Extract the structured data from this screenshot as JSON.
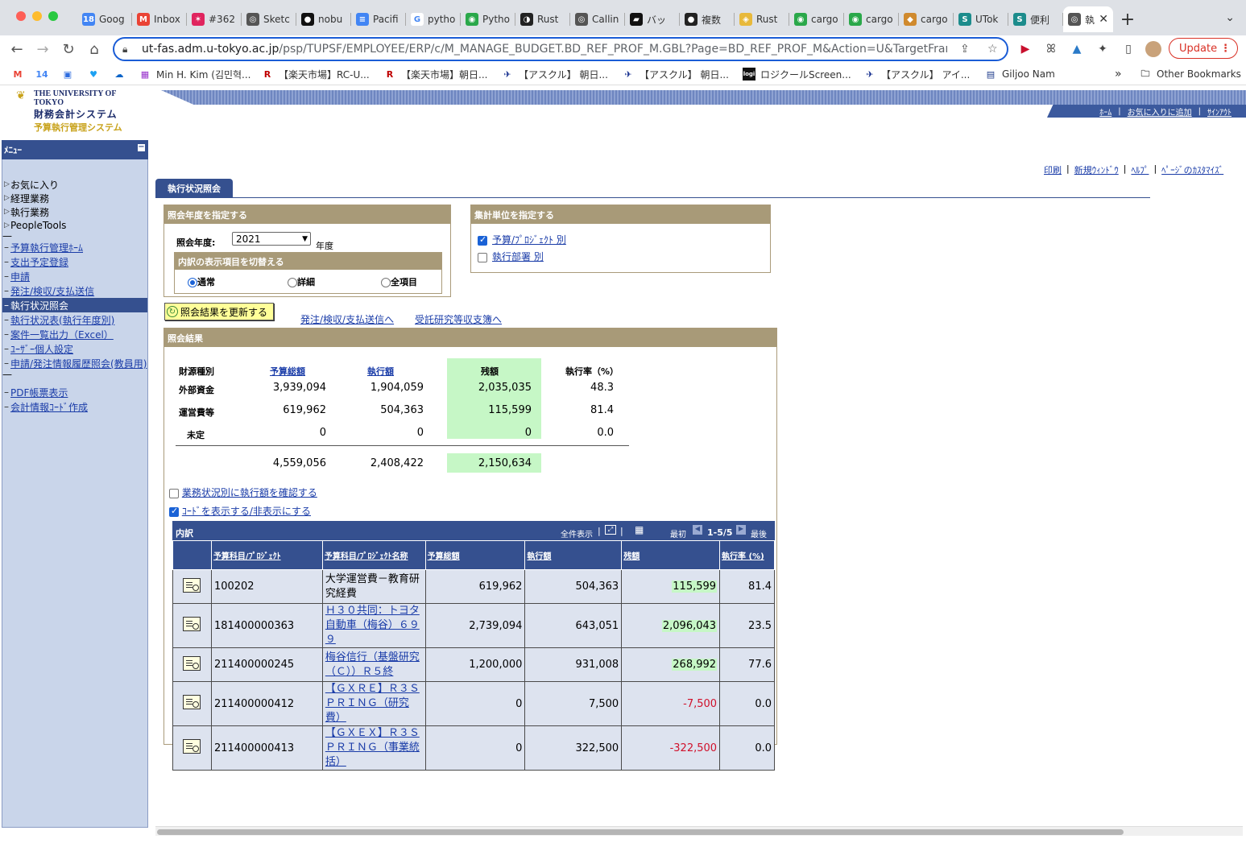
{
  "browser": {
    "tabs": [
      {
        "label": "Goog",
        "fav_color": "#4285f4",
        "fav": "18"
      },
      {
        "label": "Inbox",
        "fav_color": "#ea4335",
        "fav": "M"
      },
      {
        "label": "#362",
        "fav_color": "#e0245e",
        "fav": "✶"
      },
      {
        "label": "Sketc",
        "fav_color": "#555555",
        "fav": "◎"
      },
      {
        "label": "nobu",
        "fav_color": "#111111",
        "fav": "●"
      },
      {
        "label": "Pacifi",
        "fav_color": "#4285f4",
        "fav": "≡"
      },
      {
        "label": "pytho",
        "fav_color": "#ffffff",
        "fav": "G"
      },
      {
        "label": "Pytho",
        "fav_color": "#2aa84a",
        "fav": "◉"
      },
      {
        "label": "Rust",
        "fav_color": "#222222",
        "fav": "◑"
      },
      {
        "label": "Callin",
        "fav_color": "#555555",
        "fav": "◎"
      },
      {
        "label": "バッ",
        "fav_color": "#111111",
        "fav": "▰"
      },
      {
        "label": "複数",
        "fav_color": "#222222",
        "fav": "●"
      },
      {
        "label": "Rust",
        "fav_color": "#e8b93b",
        "fav": "◈"
      },
      {
        "label": "cargo",
        "fav_color": "#2aa84a",
        "fav": "◉"
      },
      {
        "label": "cargo",
        "fav_color": "#2aa84a",
        "fav": "◉"
      },
      {
        "label": "cargo",
        "fav_color": "#d08a2e",
        "fav": "◆"
      },
      {
        "label": "UTok",
        "fav_color": "#1c8c8c",
        "fav": "S"
      },
      {
        "label": "便利",
        "fav_color": "#1c8c8c",
        "fav": "S"
      }
    ],
    "active_tab": {
      "label": "執",
      "fav": "◎"
    },
    "new_tab_icon": "+",
    "url_host": "ut-fas.adm.u-tokyo.ac.jp",
    "url_path": "/psp/TUPSF/EMPLOYEE/ERP/c/M_MANAGE_BUDGET.BD_REF_PROF_M.GBL?Page=BD_REF_PROF_M&Action=U&TargetFram...",
    "update_label": "Update",
    "bookmarks": [
      {
        "label": "",
        "icon": "M",
        "color": "#ea4335"
      },
      {
        "label": "",
        "icon": "14",
        "color": "#4285f4"
      },
      {
        "label": "",
        "icon": "▣",
        "color": "#2d6cdf"
      },
      {
        "label": "",
        "icon": "♥",
        "color": "#1da1f2"
      },
      {
        "label": "",
        "icon": "☁",
        "color": "#0a64c8"
      },
      {
        "label": "Min H. Kim (김민혁...",
        "icon": "▦",
        "color": "#9933cc"
      },
      {
        "label": "【楽天市場】RC-U...",
        "icon": "R",
        "color": "#bf0000"
      },
      {
        "label": "【楽天市場】朝日...",
        "icon": "R",
        "color": "#bf0000"
      },
      {
        "label": "【アスクル】 朝日...",
        "icon": "✈",
        "color": "#102a8c"
      },
      {
        "label": "【アスクル】 朝日...",
        "icon": "✈",
        "color": "#102a8c"
      },
      {
        "label": "ロジクールScreen...",
        "icon": "logi",
        "color": "#111111"
      },
      {
        "label": "【アスクル】 アイ...",
        "icon": "✈",
        "color": "#102a8c"
      },
      {
        "label": "Giljoo Nam",
        "icon": "▤",
        "color": "#1d3a8a"
      }
    ],
    "bookmarks_more": "»",
    "other_bookmarks": "Other Bookmarks"
  },
  "header": {
    "logo_line1": "THE UNIVERSITY OF TOKYO",
    "logo_line2": "財務会計システム",
    "logo_line3": "予算執行管理システム",
    "nav": [
      "ﾎｰﾑ",
      "お気に入りに追加",
      "ｻｲﾝｱｳﾄ"
    ],
    "util_links": [
      "印刷",
      "新規ｳｨﾝﾄﾞｳ",
      "ﾍﾙﾌﾟ",
      "ﾍﾟｰｼﾞのｶｽﾀﾏｲｽﾞ"
    ]
  },
  "menu": {
    "title": "ﾒﾆｭｰ",
    "folders": [
      "お気に入り",
      "経理業務",
      "執行業務",
      "PeopleTools"
    ],
    "links_a": [
      "予算執行管理ﾎｰﾑ",
      "支出予定登録",
      "申請",
      "発注/検収/支払送信"
    ],
    "active": "執行状況照会",
    "links_b": [
      "執行状況表(執行年度別)",
      "案件一覧出力（Excel）",
      "ﾕｰｻﾞｰ個人設定",
      "申請/発注情報履歴照会(教員用)"
    ],
    "links_c": [
      "PDF帳票表示",
      "会計情報ｺｰﾄﾞ作成"
    ]
  },
  "page_tab": "執行状況照会",
  "year_box": {
    "title": "照会年度を指定する",
    "label": "照会年度:",
    "value": "2021",
    "suffix": "年度",
    "sub_title": "内訳の表示項目を切替える",
    "radios": [
      {
        "label": "通常",
        "checked": true
      },
      {
        "label": "詳細",
        "checked": false
      },
      {
        "label": "全項目",
        "checked": false
      }
    ]
  },
  "unit_box": {
    "title": "集計単位を指定する",
    "checks": [
      {
        "label": "予算/ﾌﾟﾛｼﾞｪｸﾄ 別",
        "checked": true
      },
      {
        "label": "執行部署 別",
        "checked": false
      }
    ]
  },
  "actions": {
    "refresh": "照会結果を更新する",
    "link1": "発注/検収/支払送信へ",
    "link2": "受託研究等収支簿へ"
  },
  "results": {
    "title": "照会結果",
    "headers": [
      "財源種別",
      "予算総額",
      "執行額",
      "残額",
      "執行率（%）"
    ],
    "rows": [
      [
        "外部資金",
        "3,939,094",
        "1,904,059",
        "2,035,035",
        "48.3"
      ],
      [
        "運営費等",
        "619,962",
        "504,363",
        "115,599",
        "81.4"
      ],
      [
        "未定",
        "0",
        "0",
        "0",
        "0.0"
      ]
    ],
    "totals": [
      "4,559,056",
      "2,408,422",
      "2,150,634"
    ],
    "check1": "業務状況別に執行額を確認する",
    "check2": "ｺｰﾄﾞを表示する/非表示にする",
    "check1_on": false,
    "check2_on": true
  },
  "detail": {
    "title": "内訳",
    "show_all": "全件表示",
    "first": "最初",
    "range": "1-5/5",
    "last": "最後",
    "headers": [
      "予算科目/ﾌﾟﾛｼﾞｪｸﾄ",
      "予算科目/ﾌﾟﾛｼﾞｪｸﾄ名称",
      "予算総額",
      "執行額",
      "残額",
      "執行率 (%)"
    ],
    "rows": [
      {
        "code": "100202",
        "name": "大学運営費－教育研究経費",
        "link": false,
        "budget": "619,962",
        "exec": "504,363",
        "rest": "115,599",
        "neg": false,
        "rate": "81.4"
      },
      {
        "code": "181400000363",
        "name": "Ｈ３０共同：トヨタ自動車（梅谷）６９９",
        "link": true,
        "budget": "2,739,094",
        "exec": "643,051",
        "rest": "2,096,043",
        "neg": false,
        "rate": "23.5"
      },
      {
        "code": "211400000245",
        "name": "梅谷信行（基盤研究（Ｃ））Ｒ５終",
        "link": true,
        "budget": "1,200,000",
        "exec": "931,008",
        "rest": "268,992",
        "neg": false,
        "rate": "77.6"
      },
      {
        "code": "211400000412",
        "name": "【ＧＸＲＥ】Ｒ３ＳＰＲＩＮＧ（研究費）",
        "link": true,
        "budget": "0",
        "exec": "7,500",
        "rest": "-7,500",
        "neg": true,
        "rate": "0.0"
      },
      {
        "code": "211400000413",
        "name": "【ＧＸＥＸ】Ｒ３ＳＰＲＩＮＧ（事業統括）",
        "link": true,
        "budget": "0",
        "exec": "322,500",
        "rest": "-322,500",
        "neg": true,
        "rate": "0.0"
      }
    ]
  }
}
